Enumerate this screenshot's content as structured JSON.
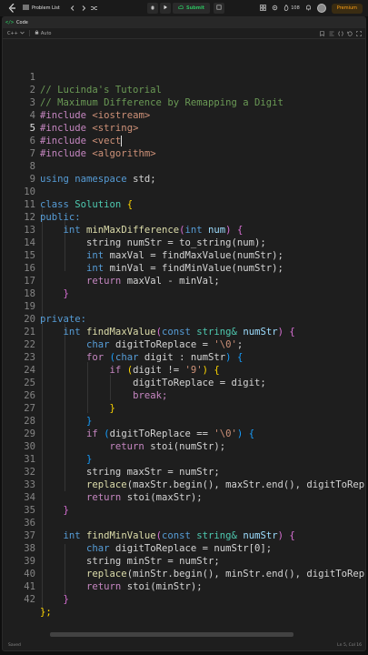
{
  "topbar": {
    "problem_list_label": "Problem List",
    "submit_label": "Submit",
    "streak_count": "108",
    "premium_label": "Premium"
  },
  "panel": {
    "title": "Code",
    "language": "C++",
    "auto_label": "Auto"
  },
  "editor": {
    "active_line": 5,
    "lines": [
      {
        "n": "1"
      },
      {
        "n": "2"
      },
      {
        "n": "3"
      },
      {
        "n": "4"
      },
      {
        "n": "5"
      },
      {
        "n": "6"
      },
      {
        "n": "7"
      },
      {
        "n": "8"
      },
      {
        "n": "9"
      },
      {
        "n": "10"
      },
      {
        "n": "11"
      },
      {
        "n": "12"
      },
      {
        "n": "13"
      },
      {
        "n": "14"
      },
      {
        "n": "15"
      },
      {
        "n": "16"
      },
      {
        "n": "17"
      },
      {
        "n": "18"
      },
      {
        "n": "19"
      },
      {
        "n": "20"
      },
      {
        "n": "21"
      },
      {
        "n": "22"
      },
      {
        "n": "23"
      },
      {
        "n": "24"
      },
      {
        "n": "25"
      },
      {
        "n": "26"
      },
      {
        "n": "27"
      },
      {
        "n": "28"
      },
      {
        "n": "29"
      },
      {
        "n": "30"
      },
      {
        "n": "31"
      },
      {
        "n": "32"
      },
      {
        "n": "33"
      },
      {
        "n": "34"
      },
      {
        "n": "35"
      },
      {
        "n": "36"
      },
      {
        "n": "37"
      },
      {
        "n": "38"
      },
      {
        "n": "39"
      },
      {
        "n": "40"
      },
      {
        "n": "41"
      },
      {
        "n": "42"
      }
    ],
    "code": {
      "l1": "// Lucinda's Tutorial",
      "l2": "// Maximum Difference by Remapping a Digit",
      "l3_pp": "#include",
      "l3_inc": "<iostream>",
      "l4_pp": "#include",
      "l4_inc": "<string>",
      "l5_pp": "#include",
      "l5_inc": "<vect",
      "l6_pp": "#include",
      "l6_inc": "<algorithm>",
      "l8_using": "using",
      "l8_namespace": "namespace",
      "l8_std": "std;",
      "l10_class": "class",
      "l10_name": "Solution",
      "l10_brace": "{",
      "l11": "public:",
      "l12_int": "int",
      "l12_fn": "minMaxDifference",
      "l12_open": "(",
      "l12_int2": "int",
      "l12_arg": "num",
      "l12_close": ")",
      "l12_brace": "{",
      "l13": "string numStr = to_string(num);",
      "l14_int": "int",
      "l14_rest": "maxVal = findMaxValue(numStr);",
      "l15_int": "int",
      "l15_rest": "minVal = findMinValue(numStr);",
      "l16_ret": "return",
      "l16_rest": "maxVal - minVal;",
      "l17": "}",
      "l19": "private:",
      "l20_int": "int",
      "l20_fn": "findMaxValue",
      "l20_open": "(",
      "l20_const": "const",
      "l20_type": "string&",
      "l20_arg": "numStr",
      "l20_close": ")",
      "l20_brace": "{",
      "l21_char": "char",
      "l21_rest": "digitToReplace = ",
      "l21_str": "'\\0'",
      "l21_end": ";",
      "l22_for": "for",
      "l22_open": "(",
      "l22_char": "char",
      "l22_rest": "digit : numStr",
      "l22_close": ")",
      "l22_brace": "{",
      "l23_if": "if",
      "l23_open": "(",
      "l23_rest": "digit != ",
      "l23_str": "'9'",
      "l23_close": ")",
      "l23_brace": "{",
      "l24": "digitToReplace = digit;",
      "l25": "break;",
      "l26": "}",
      "l27": "}",
      "l28_if": "if",
      "l28_open": "(",
      "l28_rest": "digitToReplace == ",
      "l28_str": "'\\0'",
      "l28_close": ")",
      "l28_brace": "{",
      "l29_ret": "return",
      "l29_rest": "stoi(numStr);",
      "l30": "}",
      "l31": "string maxStr = numStr;",
      "l32_fn": "replace",
      "l32_rest": "(maxStr.begin(), maxStr.end(), digitToRepl",
      "l33_ret": "return",
      "l33_rest": "stoi(maxStr);",
      "l34": "}",
      "l36_int": "int",
      "l36_fn": "findMinValue",
      "l36_open": "(",
      "l36_const": "const",
      "l36_type": "string&",
      "l36_arg": "numStr",
      "l36_close": ")",
      "l36_brace": "{",
      "l37_char": "char",
      "l37_rest": "digitToReplace = numStr[0];",
      "l38": "string minStr = numStr;",
      "l39_fn": "replace",
      "l39_rest": "(minStr.begin(), minStr.end(), digitToRepl",
      "l40_ret": "return",
      "l40_rest": "stoi(minStr);",
      "l41": "}",
      "l42": "};"
    }
  },
  "status": {
    "left": "Saved",
    "right": "Ln 5, Col 16"
  },
  "colors": {
    "keyword": "#569cd6",
    "comment": "#6a9955",
    "string": "#ce9178",
    "function": "#dcdcaa",
    "submit_green": "#2cbb5d",
    "premium_orange": "#ffa116"
  }
}
